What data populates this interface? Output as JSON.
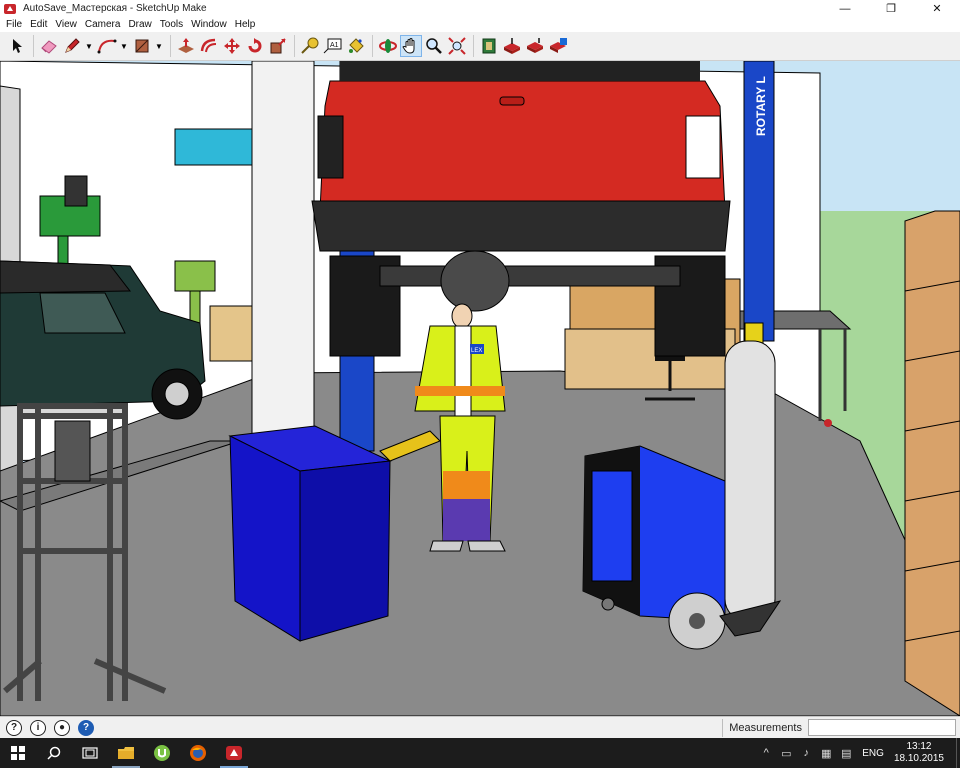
{
  "window": {
    "title": "AutoSave_Мастерская - SketchUp Make",
    "controls": {
      "minimize": "—",
      "restore": "❐",
      "close": "✕"
    }
  },
  "menu": [
    "File",
    "Edit",
    "View",
    "Camera",
    "Draw",
    "Tools",
    "Window",
    "Help"
  ],
  "toolbar": {
    "tools": [
      {
        "name": "select-tool",
        "icon": "arrow-icon"
      },
      {
        "name": "eraser-tool",
        "icon": "eraser-icon"
      },
      {
        "name": "line-tool",
        "icon": "pencil-icon"
      },
      {
        "name": "arc-tool",
        "icon": "arc-icon"
      },
      {
        "name": "shape-tool",
        "icon": "rectangle-icon"
      },
      {
        "name": "push-pull-tool",
        "icon": "push-pull-icon"
      },
      {
        "name": "offset-tool",
        "icon": "offset-icon"
      },
      {
        "name": "move-tool",
        "icon": "move-icon"
      },
      {
        "name": "rotate-tool",
        "icon": "rotate-icon"
      },
      {
        "name": "scale-tool",
        "icon": "scale-icon"
      },
      {
        "name": "tape-measure-tool",
        "icon": "tape-icon"
      },
      {
        "name": "text-tool",
        "icon": "text-icon"
      },
      {
        "name": "paint-bucket-tool",
        "icon": "bucket-icon"
      },
      {
        "name": "orbit-tool",
        "icon": "orbit-icon"
      },
      {
        "name": "pan-tool",
        "icon": "hand-icon"
      },
      {
        "name": "zoom-tool",
        "icon": "magnifier-icon"
      },
      {
        "name": "zoom-extents-tool",
        "icon": "zoom-extents-icon"
      },
      {
        "name": "warehouse-tool",
        "icon": "warehouse-icon"
      },
      {
        "name": "get-models-tool",
        "icon": "get-models-icon"
      },
      {
        "name": "share-model-tool",
        "icon": "share-model-icon"
      },
      {
        "name": "extension-warehouse-tool",
        "icon": "extension-icon"
      }
    ],
    "active": "pan-tool"
  },
  "scene": {
    "lift_label": "ROTARY L",
    "badge_text": "LEX"
  },
  "status": {
    "measurements_label": "Measurements",
    "measurements_value": ""
  },
  "taskbar": {
    "language": "ENG",
    "time": "13:12",
    "date": "18.10.2015"
  },
  "colors": {
    "truck_red": "#d42a22",
    "lift_blue": "#1a47c8",
    "floor_gray": "#8a8a8a",
    "bin_blue": "#1414c8",
    "welder_blue": "#1e3ef0",
    "vest_yellow": "#d9f01a",
    "vest_orange": "#f08a1a",
    "wall_white": "#ffffff",
    "sky_blue": "#c8e4f5",
    "grass_green": "#a7d79a",
    "taskbar_bg": "#1c1c1c"
  }
}
